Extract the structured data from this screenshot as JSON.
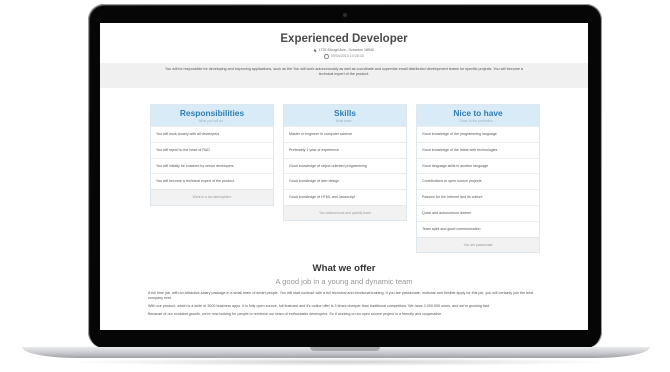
{
  "job": {
    "title": "Experienced Developer",
    "address": "1725 Slough Ave., Scranton 18540",
    "date": "09/04/2013 10:26:35",
    "intro": "You will be responsible for developing and improving applications, such as the You will work autonomously as well as coordinate and supervise email distributed development teams for specific projects. You will become a technical expert of the product."
  },
  "columns": [
    {
      "title": "Responsibilities",
      "subtitle": "What you will do...",
      "items": [
        "You will work closely with all developers",
        "You will report to the head of R&D",
        "You will initially be coached by senior developers",
        "You will become a technical expert of the product."
      ],
      "footer": "Work in a fun atmosphere"
    },
    {
      "title": "Skills",
      "subtitle": "Must have...",
      "items": [
        "Master or engineer in computer science",
        "Preferably 1 year of experience",
        "Good knowledge of object oriented programming",
        "Good knowledge of web design",
        "Good knowledge of HTML and Javascript"
      ],
      "footer": "You autonomous and quickly learn"
    },
    {
      "title": "Nice to have",
      "subtitle": "Close to the perfection ...",
      "items": [
        "Good knowledge of the programming language",
        "Good knowledge of the latest web technologies",
        "Good language skills in another language",
        "Contributions to open source projects",
        "Passion for the Internet and its culture",
        "Quick and autonomous learner",
        "Team spirit and good communication"
      ],
      "footer": "You are passionate"
    }
  ],
  "offer": {
    "title": "What we offer",
    "subtitle": "A good job in a young and dynamic team",
    "paragraphs": [
      "A full time job, with an attractive salary package in a small team of smart people. You will start contract with a full technical and functional training. If you are passionate, motivate and flexible apply for this job, you will certainly join the best company ever.",
      "With our product, which is a suite of 3000 business apps. It is fully open source, full featured and it's online offer is 3 times cheaper than traditional competitors. We have 2.000.000 users, and we're growing fast.",
      "Because of our constant growth, we're now looking for people to reinforce our team of enthusiastic developers. So if working on an open source project in a friendly and cooperative"
    ]
  }
}
